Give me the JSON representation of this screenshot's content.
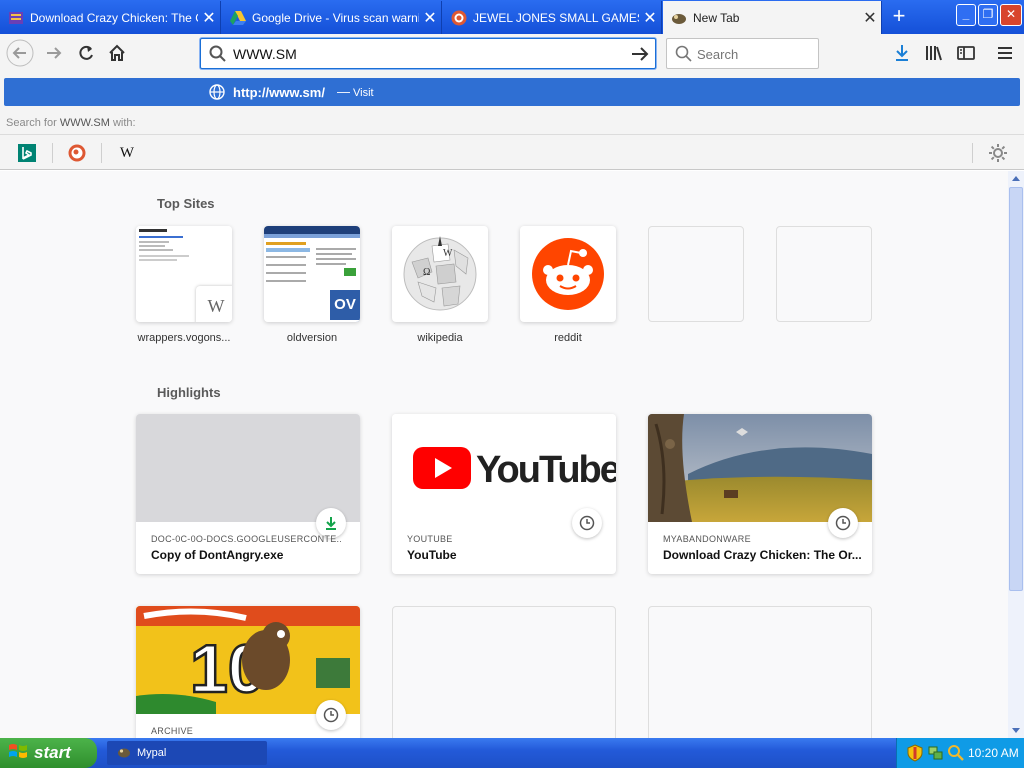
{
  "tabs": [
    {
      "title": "Download Crazy Chicken: The Or",
      "icon": "myabandonware-icon"
    },
    {
      "title": "Google Drive - Virus scan warning",
      "icon": "google-drive-icon"
    },
    {
      "title": "JEWEL JONES SMALL GAMES.WS",
      "icon": "duckduckgo-icon"
    },
    {
      "title": "New Tab",
      "icon": "mypal-icon"
    }
  ],
  "urlbar": {
    "value": "WWW.SM"
  },
  "searchbar": {
    "placeholder": "Search"
  },
  "dropdown": {
    "suggestion_url": "http://www.sm/",
    "suggestion_sep": "—",
    "suggestion_action": "Visit",
    "search_for_prefix": "Search for",
    "search_for_term": "WWW.SM",
    "search_for_suffix": "with:",
    "engines": [
      "bing-icon",
      "duckduckgo-icon",
      "wikipedia-icon"
    ],
    "wikipedia_glyph": "W"
  },
  "top_sites": {
    "title": "Top Sites",
    "items": [
      {
        "label": "wrappers.vogons...",
        "badge": "W"
      },
      {
        "label": "oldversion",
        "badge": "OV"
      },
      {
        "label": "wikipedia"
      },
      {
        "label": "reddit"
      },
      {
        "label": ""
      },
      {
        "label": ""
      }
    ]
  },
  "highlights": {
    "title": "Highlights",
    "items": [
      {
        "source": "DOC-0C-0O-DOCS.GOOGLEUSERCONTE...",
        "title": "Copy of DontAngry.exe",
        "badge": "download-icon"
      },
      {
        "source": "YOUTUBE",
        "title": "YouTube",
        "badge": "clock-icon",
        "image_text": "YouTube"
      },
      {
        "source": "MYABANDONWARE",
        "title": "Download Crazy Chicken: The Or...",
        "badge": "clock-icon"
      },
      {
        "source": "ARCHIVE",
        "title": "",
        "badge": "clock-icon",
        "image_text": "10"
      }
    ]
  },
  "taskbar": {
    "start_label": "start",
    "task_label": "Mypal",
    "time": "10:20 AM"
  },
  "colors": {
    "tabstrip": "#1b58e4",
    "suggestion_highlight": "#2f6fd3",
    "taskbar": "#235ad9",
    "start_button": "#2f8f2d",
    "tray": "#0f9be6"
  }
}
